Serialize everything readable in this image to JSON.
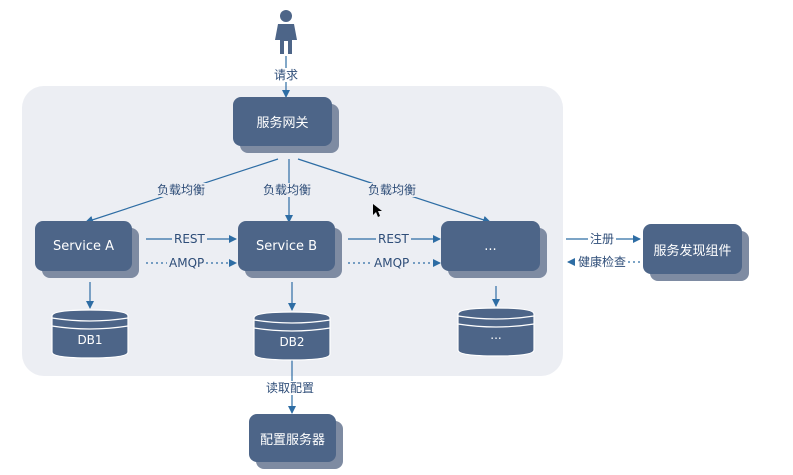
{
  "nodes": {
    "gateway": "服务网关",
    "service_a": "Service A",
    "service_b": "Service B",
    "service_c": "...",
    "discovery": "服务发现组件",
    "config": "配置服务器"
  },
  "databases": {
    "db1": "DB1",
    "db2": "DB2",
    "db3": "..."
  },
  "edges": {
    "request": "请求",
    "lb1": "负载均衡",
    "lb2": "负载均衡",
    "lb3": "负载均衡",
    "rest1": "REST",
    "amqp1": "AMQP",
    "rest2": "REST",
    "amqp2": "AMQP",
    "register": "注册",
    "health": "健康检查",
    "read_config": "读取配置"
  },
  "colors": {
    "node": "#4d6588",
    "node_shadow": "#7e8ba2",
    "panel": "#eceef3",
    "line": "#2e6da4",
    "text": "#2e4d78"
  }
}
